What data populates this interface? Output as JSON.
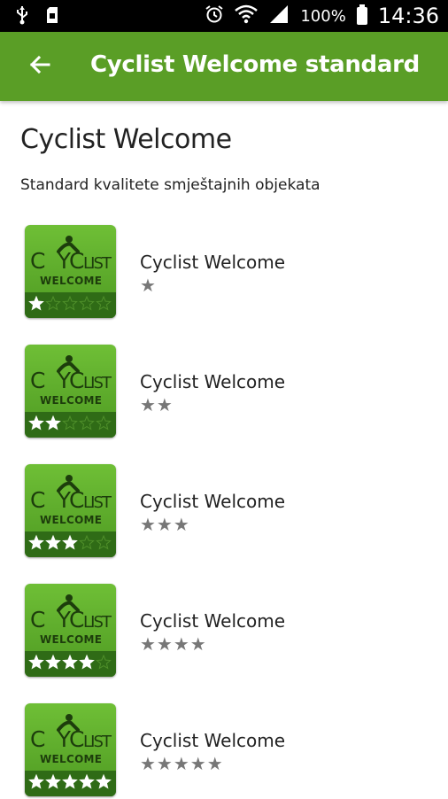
{
  "status_bar": {
    "battery_text": "100%",
    "time": "14:36"
  },
  "toolbar": {
    "title": "Cyclist Welcome standard"
  },
  "page": {
    "title": "Cyclist Welcome",
    "subtitle": "Standard kvalitete smještajnih objekata"
  },
  "items": [
    {
      "label": "Cyclist Welcome",
      "stars": "★",
      "rating": 1
    },
    {
      "label": "Cyclist Welcome",
      "stars": "★★",
      "rating": 2
    },
    {
      "label": "Cyclist Welcome",
      "stars": "★★★",
      "rating": 3
    },
    {
      "label": "Cyclist Welcome",
      "stars": "★★★★",
      "rating": 4
    },
    {
      "label": "Cyclist Welcome",
      "stars": "★★★★★",
      "rating": 5
    }
  ],
  "badge": {
    "logo_text": "CYCLIST",
    "logo_subtext": "WELCOME"
  },
  "colors": {
    "toolbar": "#5a9e26",
    "badge_light": "#6fbf36",
    "badge_dark": "#2f6b16",
    "star_grey": "#777777"
  }
}
